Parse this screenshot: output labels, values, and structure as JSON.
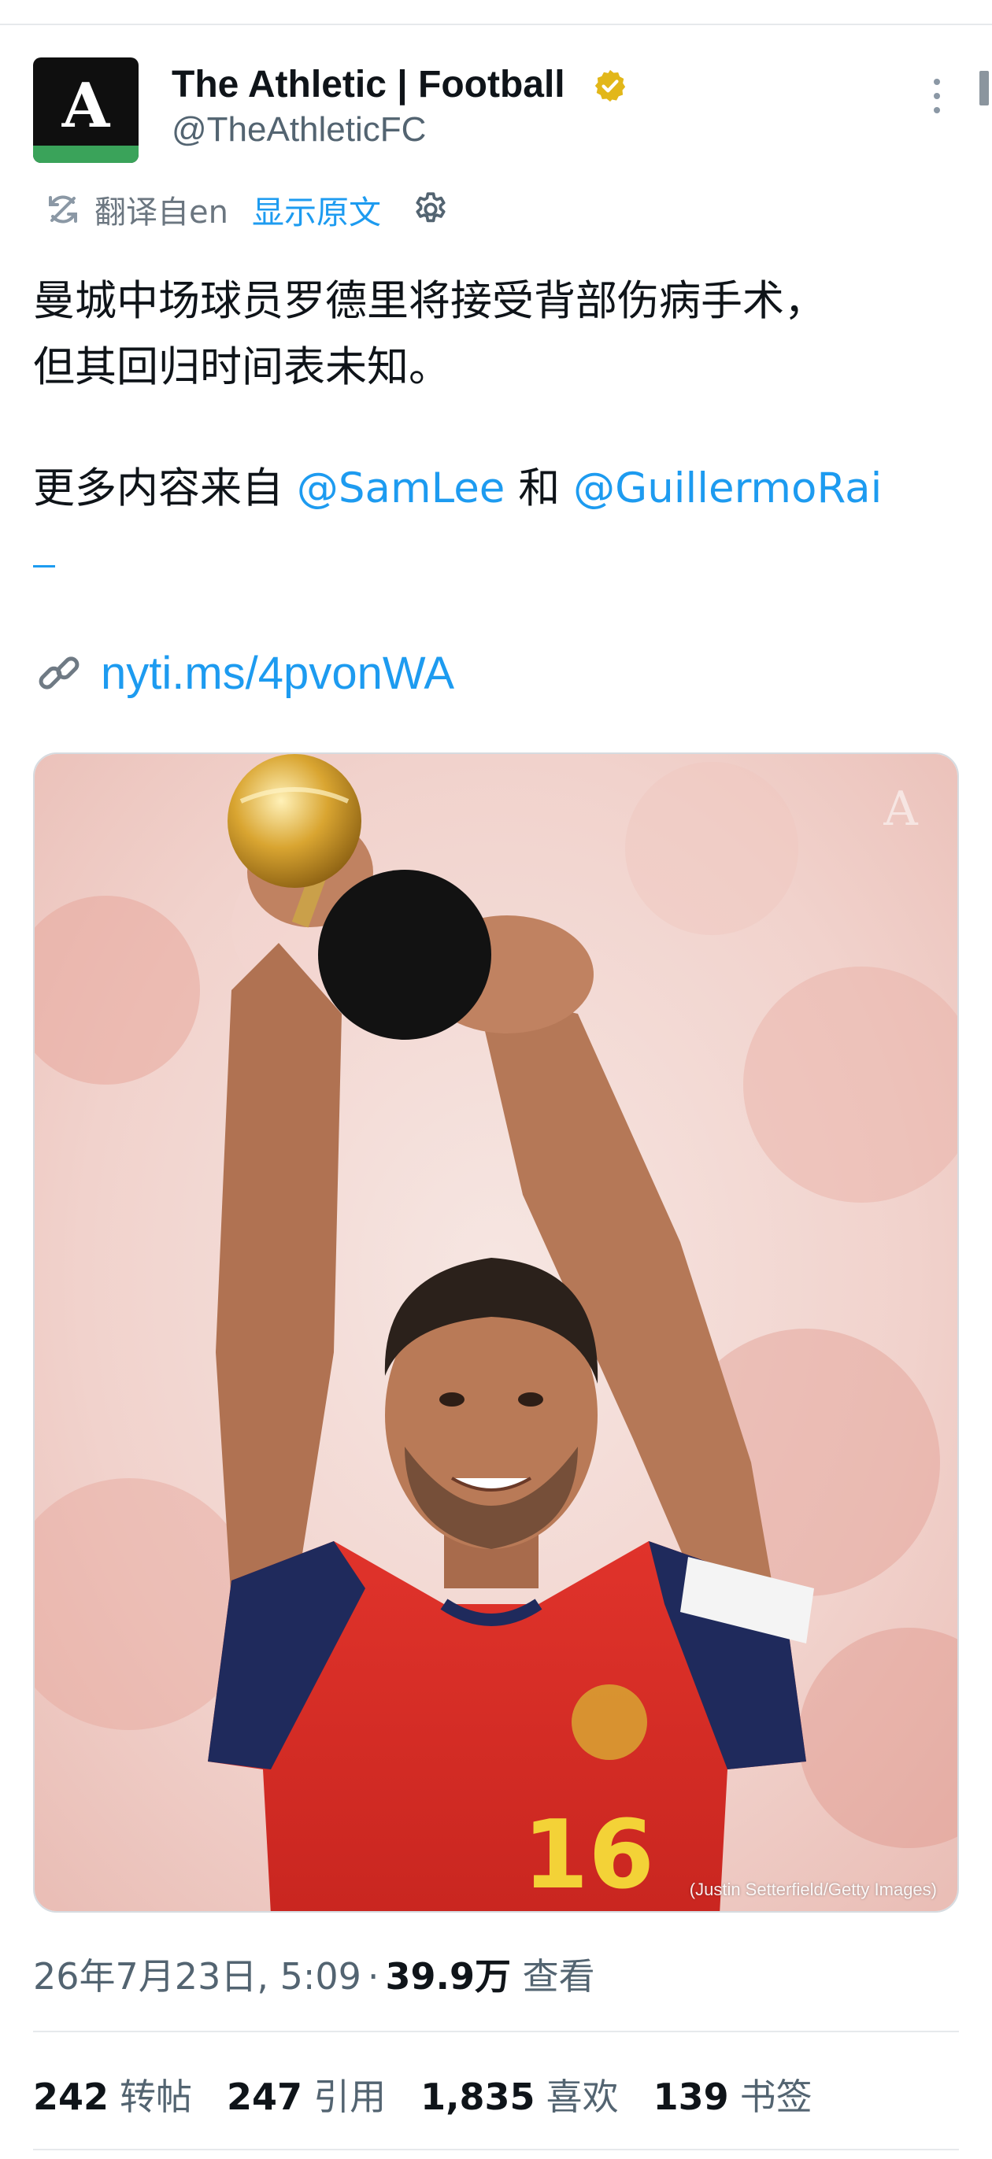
{
  "author": {
    "display_name": "The Athletic | Football",
    "handle": "@TheAthleticFC",
    "avatar_letter": "A",
    "avatar_colors": {
      "background": "#0f0f0f",
      "stripe": "#3aa35a"
    },
    "verified_badge_color": "#e2b719"
  },
  "translation": {
    "label": "翻译自en",
    "show_original_label": "显示原文"
  },
  "tweet": {
    "line1": "曼城中场球员罗德里将接受背部伤病手术，",
    "line2": "但其回归时间表未知。",
    "more_prefix": "更多内容来自 ",
    "mention1": "@SamLee",
    "connector": " 和 ",
    "mention2": "@GuillermoRai",
    "link": "nyti.ms/4pvonWA"
  },
  "media": {
    "photo_credit": "(Justin Setterfield/Getty Images)",
    "watermark_letter": "A"
  },
  "meta": {
    "timestamp": "26年7月23日, 5:09",
    "separator": "·",
    "views_count": "39.9万",
    "views_label": "查看"
  },
  "stats": [
    {
      "count": "242",
      "label": "转帖"
    },
    {
      "count": "247",
      "label": "引用"
    },
    {
      "count": "1,835",
      "label": "喜欢"
    },
    {
      "count": "139",
      "label": "书签"
    }
  ],
  "colors": {
    "link": "#1d9bf0",
    "secondary_text": "#536471",
    "primary_text": "#0f1419"
  }
}
